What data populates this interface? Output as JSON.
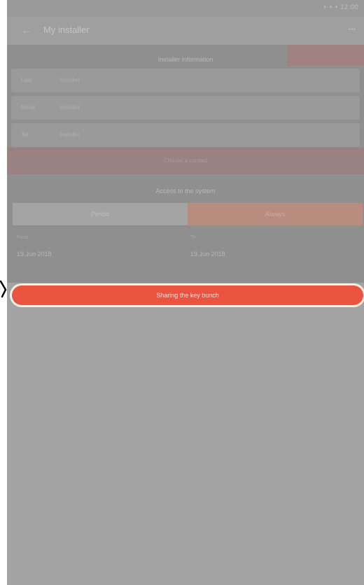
{
  "status_bar": {
    "right_text": "• • •  12:00"
  },
  "app_bar": {
    "title": "My installer",
    "action": "•••"
  },
  "section1": {
    "header": "Installer information"
  },
  "fields": [
    {
      "label": "Last",
      "value": "Installer"
    },
    {
      "label": "Name",
      "value": "Installer"
    },
    {
      "label": "Tel",
      "value": "Installer"
    }
  ],
  "band": {
    "text": "Choose a contact"
  },
  "section2": {
    "header": "Access to the system"
  },
  "segments": {
    "left": "Period",
    "right": "Always"
  },
  "dates": {
    "from_label": "From",
    "from_value": "19 Jun 2018",
    "to_label": "To",
    "to_value": "19 Jun 2018"
  },
  "share_button": {
    "label": "Sharing the key bunch"
  },
  "colors": {
    "accent": "#e9533f",
    "overlay": "#a3a3a3"
  }
}
